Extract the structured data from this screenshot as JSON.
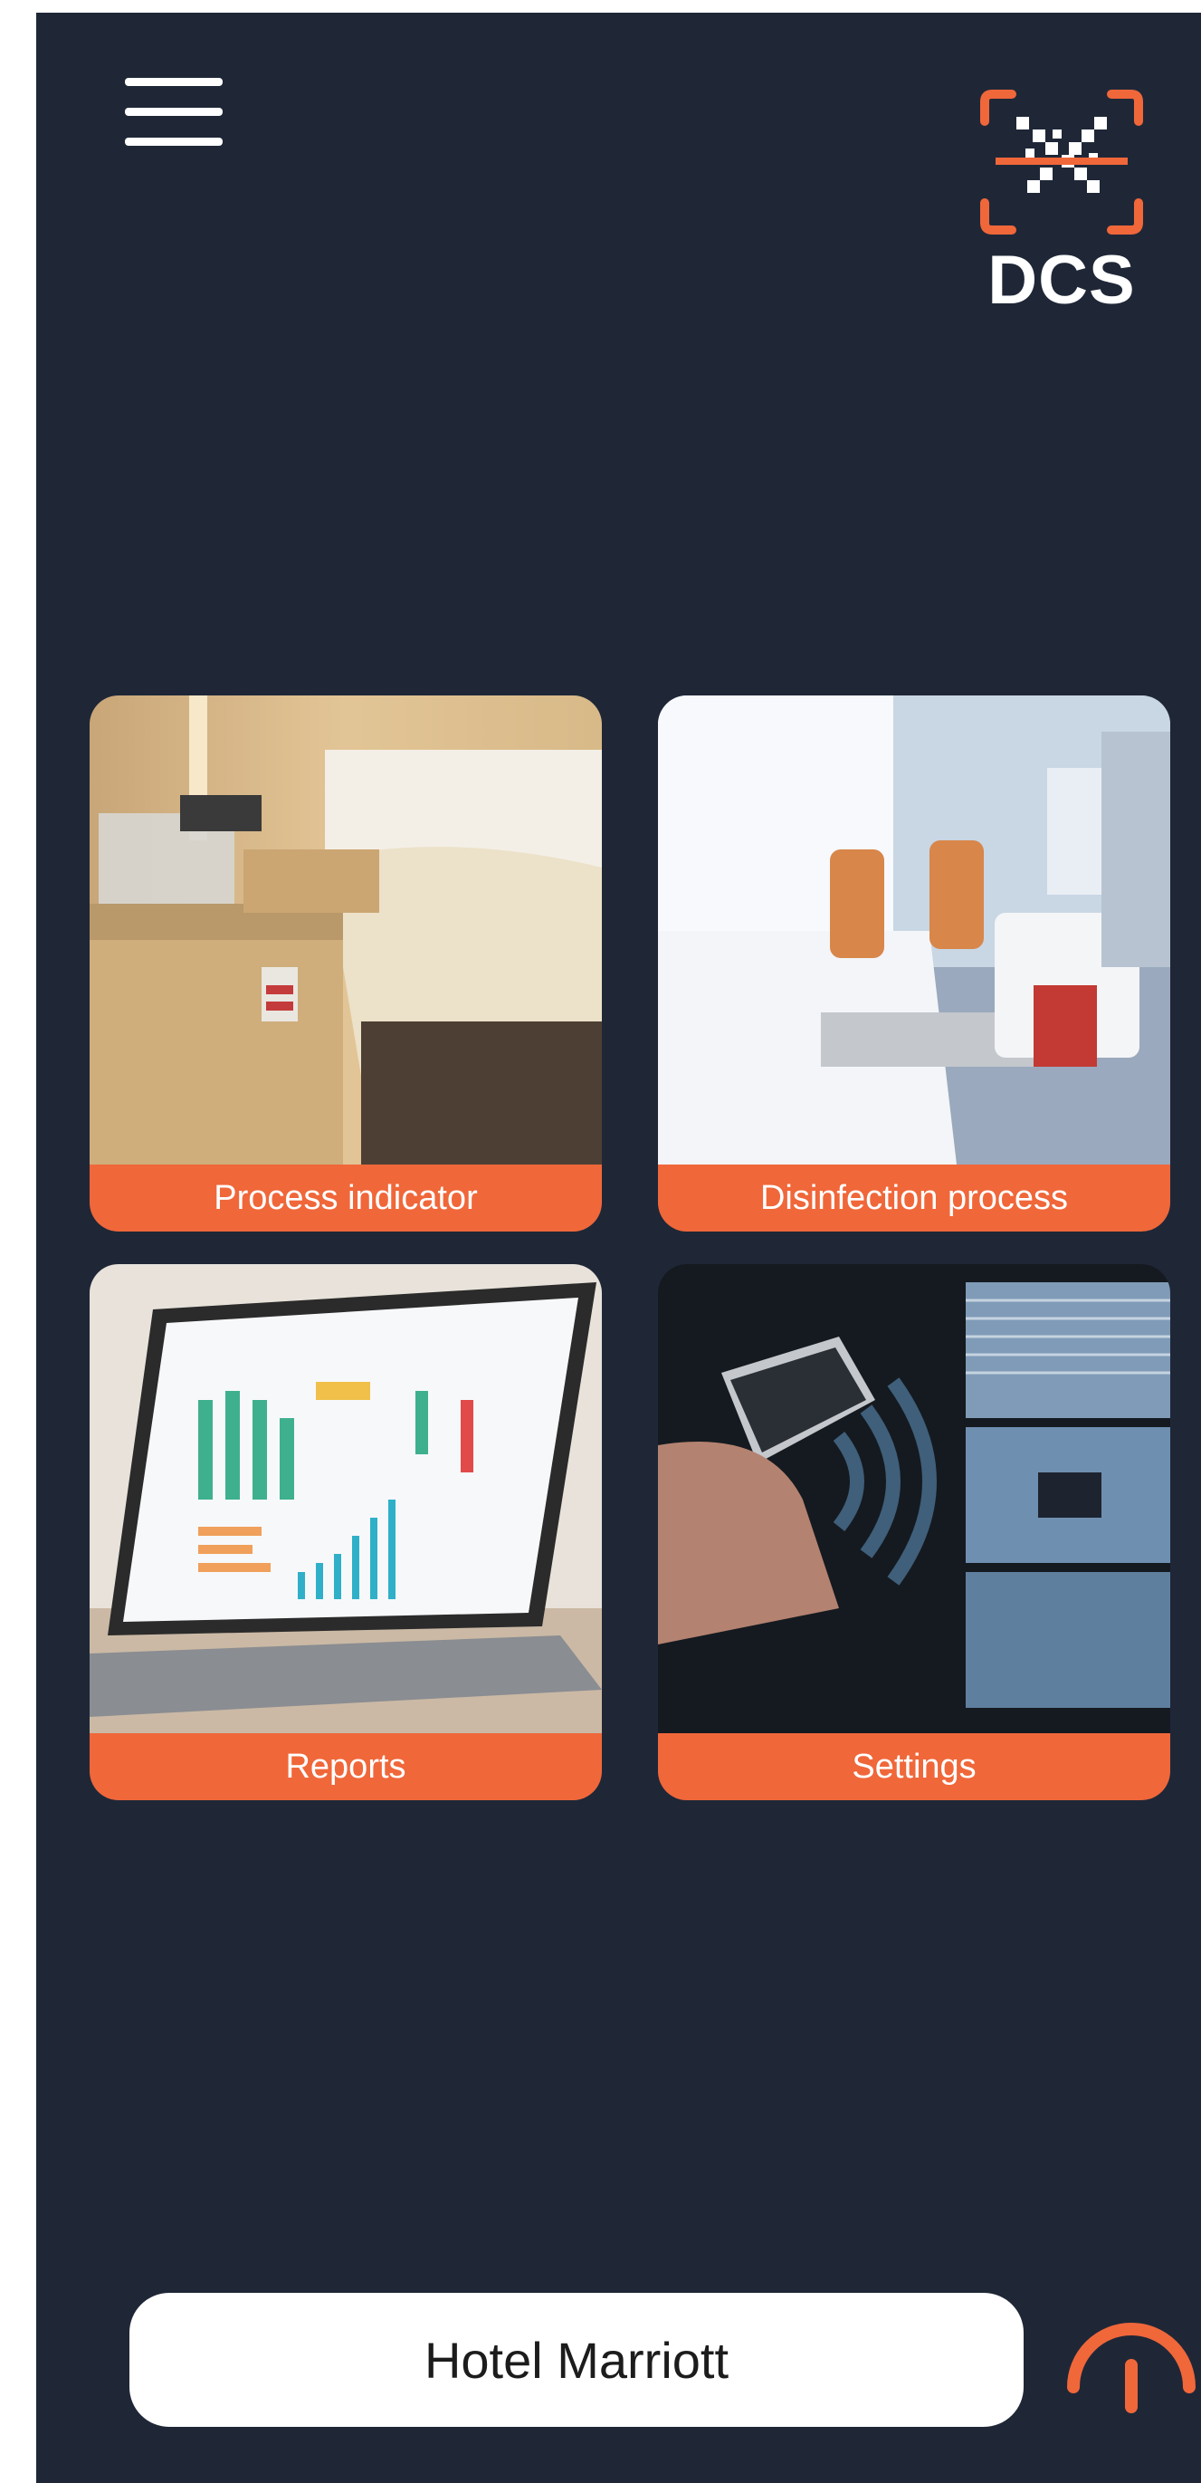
{
  "header": {
    "menu_icon": "hamburger-menu-icon",
    "logo_text": "DCS"
  },
  "tiles": [
    {
      "label": "Process indicator",
      "icon": "hotel-room-photo"
    },
    {
      "label": "Disinfection process",
      "icon": "disinfection-room-photo"
    },
    {
      "label": "Reports",
      "icon": "laptop-dashboard-photo"
    },
    {
      "label": "Settings",
      "icon": "phone-wireless-photo"
    }
  ],
  "footer": {
    "hotel_name": "Hotel Marriott",
    "action_icon": "signal-tower-icon"
  },
  "colors": {
    "background": "#1f2737",
    "accent": "#f0673a",
    "text_light": "#ffffff"
  }
}
